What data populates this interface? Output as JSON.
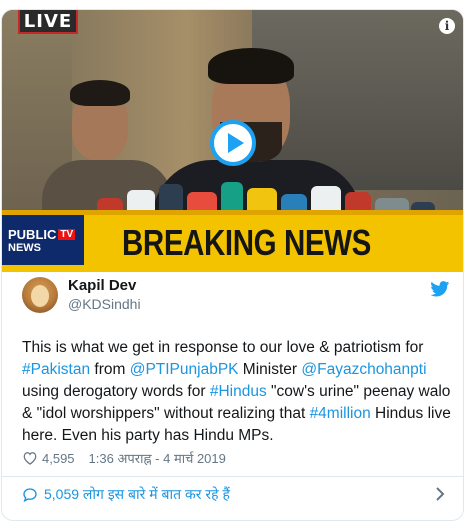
{
  "media": {
    "live_label": "LIVE",
    "info_label": "i",
    "channel_line1": "PUBLIC",
    "channel_tv": "TV",
    "channel_line2": "NEWS",
    "ticker_text": "BREAKING NEWS"
  },
  "tweet": {
    "author_name": "Kapil Dev",
    "author_handle": "@KDSindhi",
    "text_parts": {
      "p1": "This is what we get in response to our love & patriotism for ",
      "h1": "#Pakistan",
      "p2": " from ",
      "h2": "@PTIPunjabPK",
      "p3": " Minister ",
      "h3": "@Fayazchohanpti",
      "p4": " using derogatory words for ",
      "h4": "#Hindus",
      "p5": " \"cow's urine\" peenay walo & \"idol worshippers\" without realizing that ",
      "h5": "#4million",
      "p6": " Hindus live here. Even his party has Hindu MPs."
    },
    "like_count": "4,595",
    "timestamp": "1:36 अपराह्न - 4 मार्च 2019",
    "replies_text": "5,059 लोग इस बारे में बात कर रहे हैं"
  },
  "icons": {
    "bird": "twitter-bird-icon",
    "heart": "heart-icon",
    "bubble": "reply-bubble-icon",
    "chevron": "chevron-right-icon",
    "play": "play-icon",
    "info": "info-icon"
  },
  "colors": {
    "link": "#1b95e0",
    "brand": "#1da1f2",
    "ticker": "#f3c300",
    "muted": "#657786"
  }
}
